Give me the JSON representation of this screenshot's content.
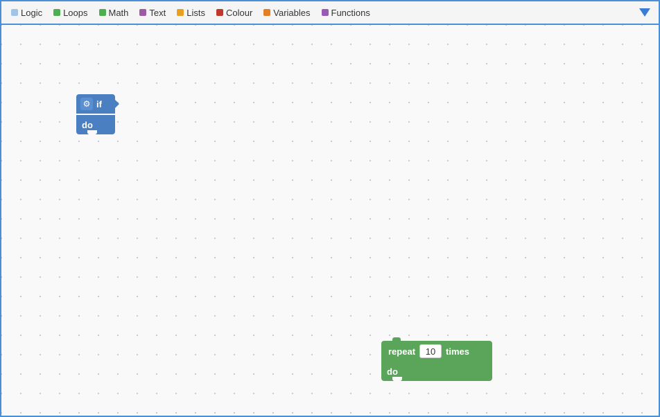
{
  "toolbar": {
    "items": [
      {
        "id": "logic",
        "label": "Logic",
        "dotClass": "dot-logic"
      },
      {
        "id": "loops",
        "label": "Loops",
        "dotClass": "dot-loops"
      },
      {
        "id": "math",
        "label": "Math",
        "dotClass": "dot-math"
      },
      {
        "id": "text",
        "label": "Text",
        "dotClass": "dot-text"
      },
      {
        "id": "lists",
        "label": "Lists",
        "dotClass": "dot-lists"
      },
      {
        "id": "colour",
        "label": "Colour",
        "dotClass": "dot-colour"
      },
      {
        "id": "variables",
        "label": "Variables",
        "dotClass": "dot-variables"
      },
      {
        "id": "functions",
        "label": "Functions",
        "dotClass": "dot-functions"
      }
    ]
  },
  "blocks": {
    "if_block": {
      "if_label": "if",
      "do_label": "do",
      "gear_icon": "⚙"
    },
    "repeat_block": {
      "repeat_label": "repeat",
      "times_label": "times",
      "do_label": "do",
      "number_value": "10"
    }
  }
}
